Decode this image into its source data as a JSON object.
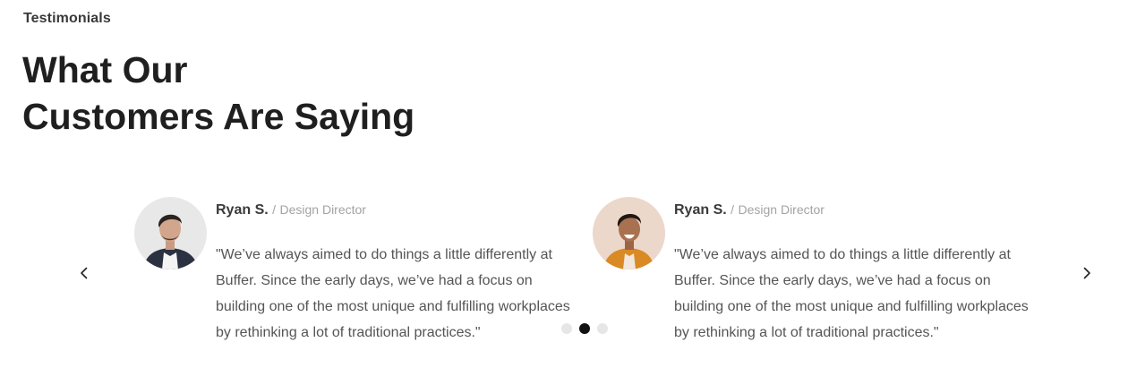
{
  "section": {
    "eyebrow": "Testimonials",
    "title_line1": "What Our",
    "title_line2": "Customers Are Saying"
  },
  "colors": {
    "heading": "#1f1f1f",
    "body_text": "#555555",
    "muted": "#a3a3a3",
    "dot_active": "#111111",
    "dot_inactive": "#e6e6e6"
  },
  "carousel": {
    "prev_icon": "chevron-left-icon",
    "next_icon": "chevron-right-icon",
    "separator": "/",
    "active_dot_index": 1,
    "dot_count": 3,
    "cards": [
      {
        "name": "Ryan S.",
        "role": "Design Director",
        "quote": "\"We’ve always aimed to do things a little differently at Buffer. Since the early days, we’ve had a focus on building one of the most unique and fulfilling workplaces by rethinking a lot of traditional practices.\"",
        "avatar": "man-portrait-grey-background"
      },
      {
        "name": "Ryan S.",
        "role": "Design Director",
        "quote": "\"We’ve always aimed to do things a little differently at Buffer. Since the early days, we’ve had a focus on building one of the most unique and fulfilling workplaces by rethinking a lot of traditional practices.\"",
        "avatar": "smiling-man-orange-jacket-peach-background"
      }
    ]
  }
}
